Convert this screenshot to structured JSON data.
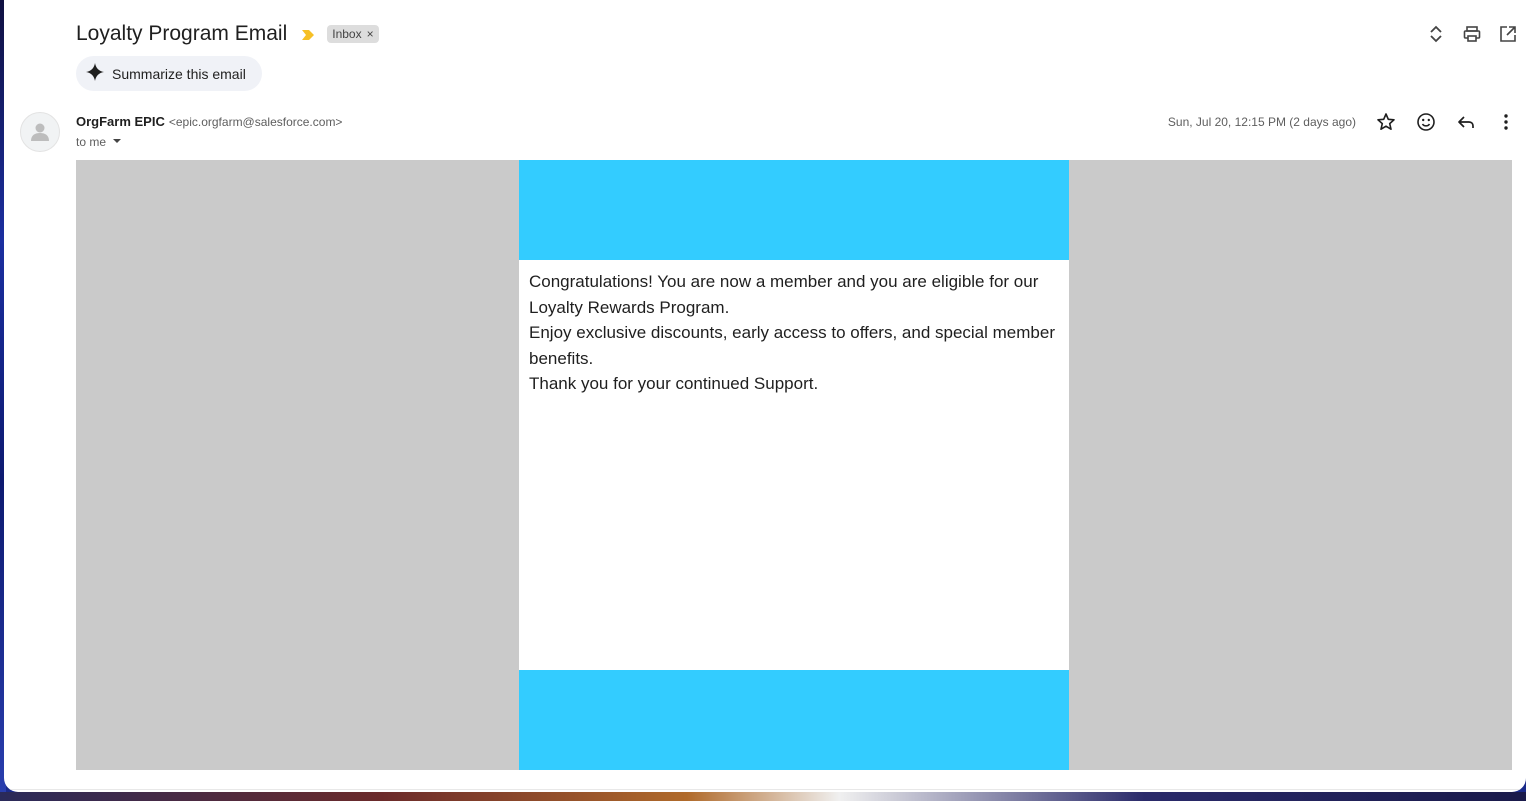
{
  "email": {
    "subject": "Loyalty Program Email",
    "label": "Inbox",
    "label_remove": "×",
    "summarize_label": "Summarize this email",
    "sender_name": "OrgFarm EPIC",
    "sender_email": "<epic.orgfarm@salesforce.com>",
    "recipient": "to me",
    "date": "Sun, Jul 20, 12:15 PM (2 days ago)"
  },
  "body": {
    "lines": [
      "Congratulations! You are now a member and you are eligible for our Loyalty Rewards Program.",
      "Enjoy exclusive discounts, early access to offers, and special member benefits.",
      "Thank you for your continued Support."
    ]
  },
  "colors": {
    "banner": "#33ccff",
    "body_background": "#cacaca",
    "importance_marker": "#f6c026"
  },
  "icons": {
    "top": [
      "expand-collapse-icon",
      "print-icon",
      "open-new-window-icon"
    ],
    "message": [
      "star-icon",
      "emoji-reaction-icon",
      "reply-icon",
      "more-options-icon"
    ]
  }
}
